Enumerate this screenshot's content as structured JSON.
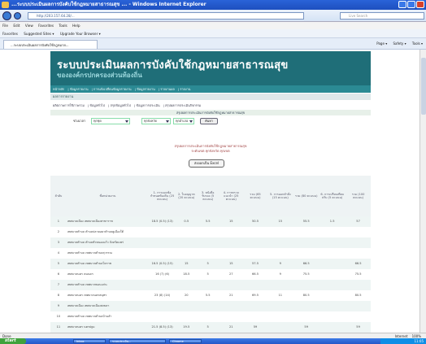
{
  "window": {
    "title": "...ระบบประเมินผลการบังคับใช้กฎหมายสาธารณสุข ... - Windows Internet Explorer"
  },
  "address": {
    "url": "http://203.157.64.28/...",
    "search_placeholder": "Live Search"
  },
  "menu": [
    "File",
    "Edit",
    "View",
    "Favorites",
    "Tools",
    "Help"
  ],
  "favorites": [
    "Favorites",
    "Suggested Sites ▾",
    "Upgrade Your Browser ▾"
  ],
  "tab": {
    "label": "...ระบบประเมินผลการบังคับใช้กฎหมาย..."
  },
  "commands": [
    "Page ▾",
    "Safety ▾",
    "Tools ▾"
  ],
  "site": {
    "title": "ระบบประเมินผลการบังคับใช้กฎหมายสาธารณสุข",
    "subtitle": "ขององค์กรปกครองส่วนท้องถิ่น",
    "nav": [
      "หน้าหลัก",
      "ข้อมูลรายงาน",
      "การแจ้งเปลี่ยนข้อมูลรายงาน",
      "ข้อมูลรายงาน",
      "รายงานผล",
      "รายงาน"
    ],
    "section": "ผลการรายงาน",
    "subnav": [
      "ผลิตภาพการใช้ภาพรวม",
      "ข้อมูลทั่วไป",
      "สรุปข้อมูลทั่วไป",
      "ข้อมูลการประเมิน",
      "สรุปผลการประเมินกิจกรรม"
    ],
    "filter_heading": "สรุปผลการประเมินการบังคับใช้กฎหมายสาธารณสุข",
    "filter_label": "ช่วงเวลา",
    "filter_values": [
      "ทุกชุด",
      "ทุกจังหวัด",
      "ทุกอำเภอ"
    ],
    "filter_button": "ค้นหา",
    "report_title_1": "สรุปผลการประเมินการบังคับใช้กฎหมายสาธารณสุข",
    "report_title_2": "ระดับเขต ทุกจังหวัด ทุกเขต",
    "excel_button": "ส่งออกเป็น Excel"
  },
  "table": {
    "headers": [
      "ลำดับ",
      "ชื่อหน่วยงาน",
      "1. การออกข้อกำหนดท้องถิ่น (25 คะแนน)",
      "2. ใบอนุญาต (20 คะแนน)",
      "3. หนังสือรับรอง (5 คะแนน)",
      "4. การตรวจแนะนำ (25 คะแนน)",
      "รวม (65 คะแนน)",
      "5. การออกคำสั่ง (15 คะแนน)",
      "รวม (80 คะแนน)",
      "6. การเปรียบเทียบปรับ (5 คะแนน)",
      "รวม (100 คะแนน)"
    ],
    "rows": [
      [
        "1",
        "เทศบาลเมือง เทศบาลเมืองสาขาราช",
        "18.5 (0.5) (13)",
        "0.5",
        "5.5",
        "15",
        "50.5",
        "15",
        "55.5",
        "1.5",
        "57"
      ],
      [
        "2",
        "เทศบาลตำบล ตำบลปลาคอยาตำบลคูเมืองใต้",
        "",
        "",
        "",
        "",
        "",
        "",
        "",
        "",
        ""
      ],
      [
        "3",
        "เทศบาลตำบล ตำบลหัวหนองแก้ว จังหวัดแพร่",
        "",
        "",
        "",
        "",
        "",
        "",
        "",
        "",
        ""
      ],
      [
        "4",
        "เทศบาลตำบล เทศบาลตำบลสุวรรณ",
        "",
        "",
        "",
        "",
        "",
        "",
        "",
        "",
        ""
      ],
      [
        "5",
        "เทศบาลตำบล เทศบาลตำบลโคราช",
        "16.5 (0.5) (15)",
        "15",
        "5",
        "15",
        "57.5",
        "9",
        "66.5",
        "",
        "66.5"
      ],
      [
        "6",
        "เทศบาลนคร คนนคร",
        "16 (7) (6)",
        "18.5",
        "5",
        "27",
        "66.5",
        "9",
        "75.5",
        "",
        "75.5"
      ],
      [
        "7",
        "เทศบาลตำบล เทศบาลขอนแก่น",
        "",
        "",
        "",
        "",
        "",
        "",
        "",
        "",
        ""
      ],
      [
        "8",
        "เทศบาลนคร เทศบาลนครสมุทร",
        "23 (8) (14)",
        "20",
        "5.5",
        "21",
        "69.5",
        "11",
        "80.5",
        "",
        "80.5"
      ],
      [
        "9",
        "เทศบาลเมือง เทศบาลเมืองสงขลา",
        "",
        "",
        "",
        "",
        "",
        "",
        "",
        "",
        ""
      ],
      [
        "10",
        "เทศบาลตำบล เทศบาลตำบลบ้านลำ",
        "",
        "",
        "",
        "",
        "",
        "",
        "",
        "",
        ""
      ],
      [
        "11",
        "เทศบาลนคร นครปฐม",
        "21.5 (8.5) (13)",
        "19.5",
        "5",
        "21",
        "59",
        "",
        "59",
        "",
        "59"
      ]
    ]
  },
  "status": {
    "left": "Done",
    "zone": "Internet",
    "zoom": "100%"
  },
  "taskbar": {
    "start": "start",
    "tasks": [
      "Inbox",
      "ระบบประเมิน...",
      "Chrome"
    ],
    "clock": "11:05"
  }
}
